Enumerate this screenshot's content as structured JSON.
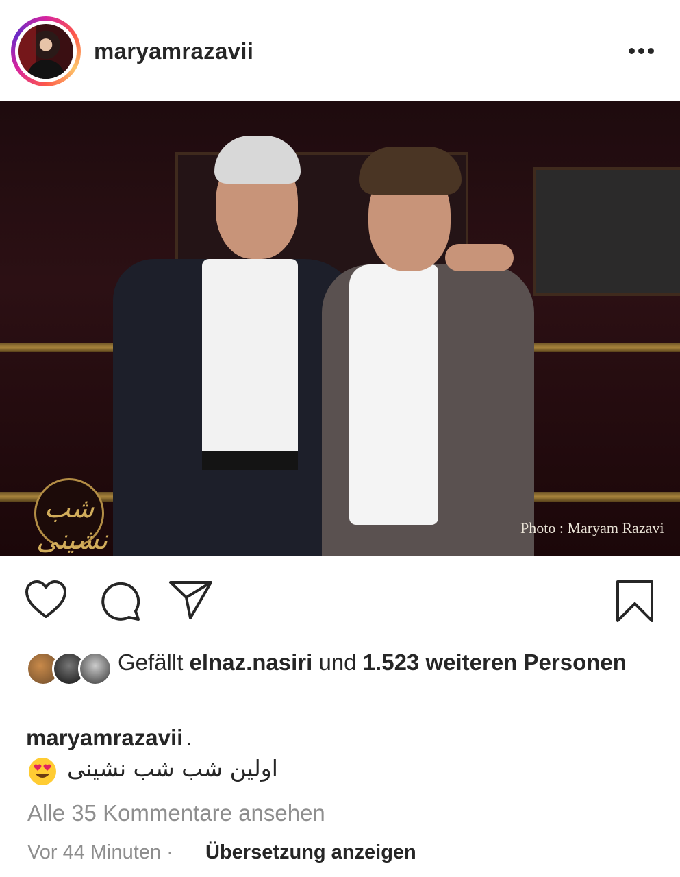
{
  "post": {
    "username": "maryamrazavii",
    "more_icon": "more-horizontal-icon"
  },
  "photo": {
    "credit": "Photo : Maryam Razavi",
    "logo_text": "شب نشینی"
  },
  "actions": {
    "like_icon": "heart-icon",
    "comment_icon": "comment-icon",
    "share_icon": "paper-plane-icon",
    "save_icon": "bookmark-icon"
  },
  "likes": {
    "prefix": "Gefällt",
    "user": "elnaz.nasiri",
    "middle": "und",
    "count": "1.523 weiteren",
    "suffix": "Personen"
  },
  "caption": {
    "username": "maryamrazavii",
    "dot": ".",
    "emoji": "heart-eyes-emoji",
    "text": "اولین شب شب نشینی"
  },
  "comments_link": "Alle 35 Kommentare ansehen",
  "timestamp": "Vor 44 Minuten",
  "separator": "·",
  "translate_label": "Übersetzung anzeigen"
}
